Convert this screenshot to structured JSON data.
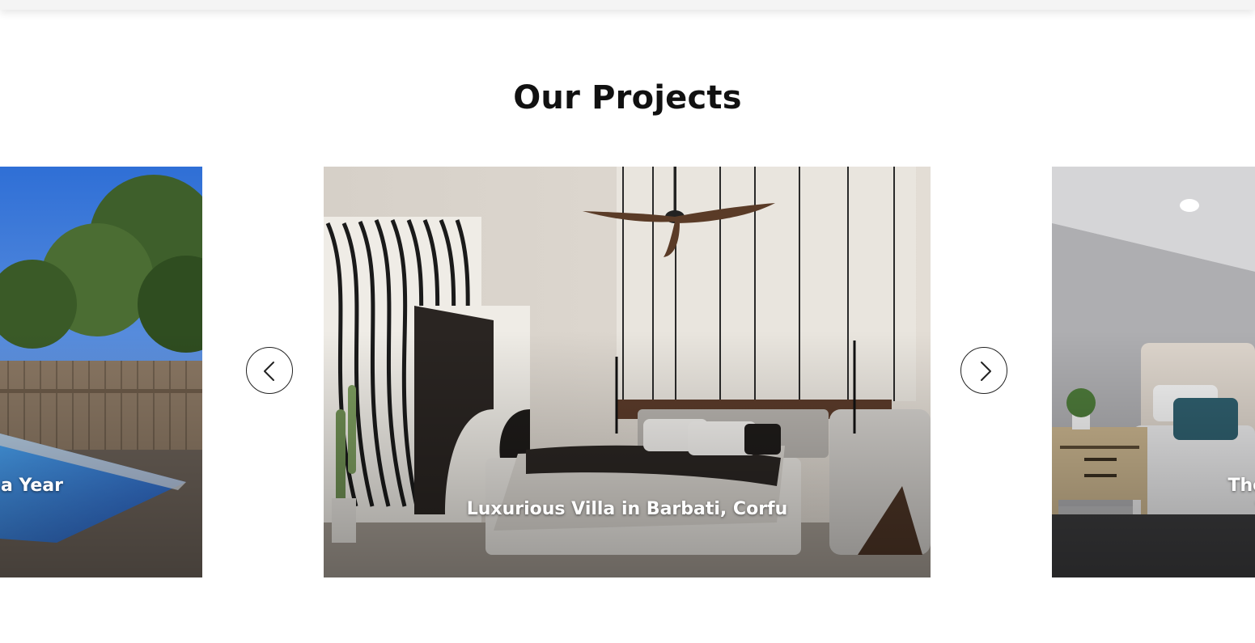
{
  "section": {
    "title": "Our Projects"
  },
  "carousel": {
    "prev_icon": "chevron-left-icon",
    "next_icon": "chevron-right-icon",
    "slides": [
      {
        "title": "…a Year",
        "visible_title": "a Year",
        "scene": "pool-backyard"
      },
      {
        "title": "Luxurious Villa in Barbati, Corfu",
        "scene": "bedroom-villa"
      },
      {
        "title": "The Gra… Ye…",
        "visible_title": "The Gra\nYe",
        "scene": "bedroom-grey"
      }
    ]
  },
  "colors": {
    "heading": "#111111",
    "card_text": "#ffffff",
    "arrow_border": "#222222"
  }
}
